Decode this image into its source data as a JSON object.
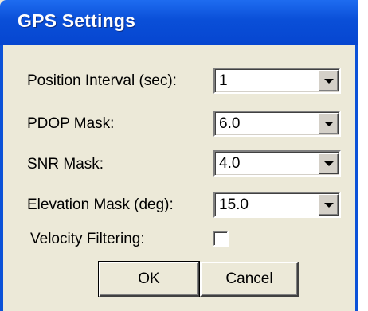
{
  "window": {
    "title": "GPS Settings"
  },
  "fields": [
    {
      "label": "Position Interval (sec):",
      "value": "1"
    },
    {
      "label": "PDOP Mask:",
      "value": "6.0"
    },
    {
      "label": "SNR Mask:",
      "value": "4.0"
    },
    {
      "label": "Elevation Mask (deg):",
      "value": "15.0"
    }
  ],
  "velocity_filtering": {
    "label": "Velocity Filtering:",
    "checked": false
  },
  "buttons": {
    "ok": "OK",
    "cancel": "Cancel"
  },
  "colors": {
    "titlebar": "#0a4fd8",
    "dialog_bg": "#ece9d8",
    "title_text": "#ffffff"
  }
}
